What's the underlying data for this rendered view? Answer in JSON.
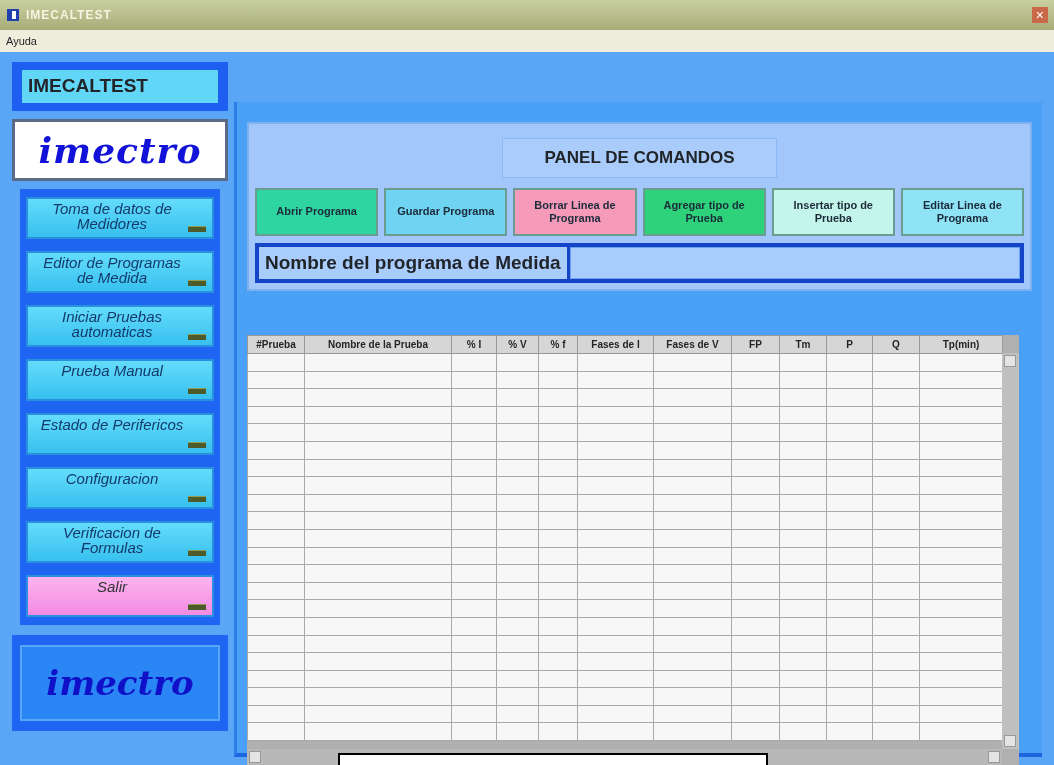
{
  "window": {
    "title": "IMECALTEST",
    "close": "×"
  },
  "menu": [
    "Ayuda"
  ],
  "sidebar": {
    "title": "IMECALTEST",
    "logo": "imectro",
    "items": [
      {
        "label": "Toma de datos de Medidores",
        "kind": "nav"
      },
      {
        "label": "Editor de Programas de Medida",
        "kind": "nav"
      },
      {
        "label": "Iniciar Pruebas automaticas",
        "kind": "nav"
      },
      {
        "label": "Prueba Manual",
        "kind": "nav"
      },
      {
        "label": "Estado de Perifericos",
        "kind": "nav"
      },
      {
        "label": "Configuracion",
        "kind": "nav"
      },
      {
        "label": "Verificacion de Formulas",
        "kind": "nav"
      },
      {
        "label": "Salir",
        "kind": "exit"
      }
    ],
    "bottom_logo": "imectro"
  },
  "panel": {
    "title": "PANEL DE COMANDOS",
    "buttons": [
      {
        "label": "Abrir Programa",
        "color": "#2fd5a0"
      },
      {
        "label": "Guardar Programa",
        "color": "#6fd3f2"
      },
      {
        "label": "Borrar Linea de Programa",
        "color": "#f59ab8"
      },
      {
        "label": "Agregar tipo de Prueba",
        "color": "#2ed27a"
      },
      {
        "label": "Insertar tipo de Prueba",
        "color": "#c4f5ea"
      },
      {
        "label": "Editar Linea de Programa",
        "color": "#8fe3f5"
      }
    ],
    "name_label": "Nombre del programa de Medida"
  },
  "table": {
    "columns": [
      "#Prueba",
      "Nombre de la Prueba",
      "% I",
      "% V",
      "% f",
      "Fases de I",
      "Fases de V",
      "FP",
      "Tm",
      "P",
      "Q",
      "Tp(min)"
    ]
  }
}
